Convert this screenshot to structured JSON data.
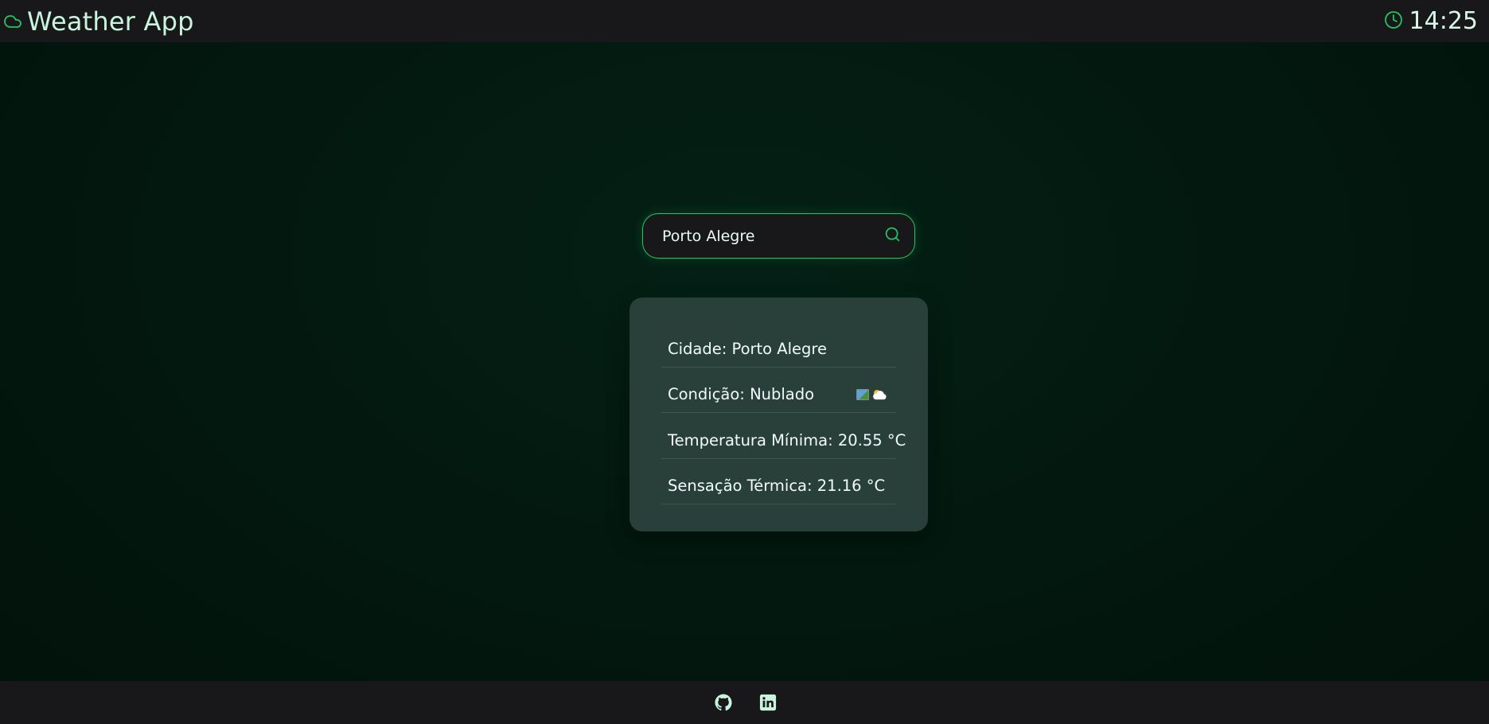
{
  "header": {
    "title": "Weather App",
    "logo_icon": "cloud-icon",
    "clock_icon": "clock-icon",
    "time": "14:25"
  },
  "search": {
    "value": "Porto Alegre",
    "button_icon": "search-icon"
  },
  "weather": {
    "city": "Cidade: Porto Alegre",
    "condition": "Condição: Nublado",
    "condition_icon": "partly-cloudy-icon",
    "temp_min": "Temperatura Mínima: 20.55 °C",
    "feels_like": "Sensação Térmica: 21.16 °C"
  },
  "footer": {
    "links": [
      {
        "icon": "github-icon"
      },
      {
        "icon": "linkedin-icon"
      }
    ]
  },
  "colors": {
    "accent": "#22c55e",
    "bar_background": "#18181b",
    "card_background": "#29403a",
    "page_background": "#03170f"
  }
}
